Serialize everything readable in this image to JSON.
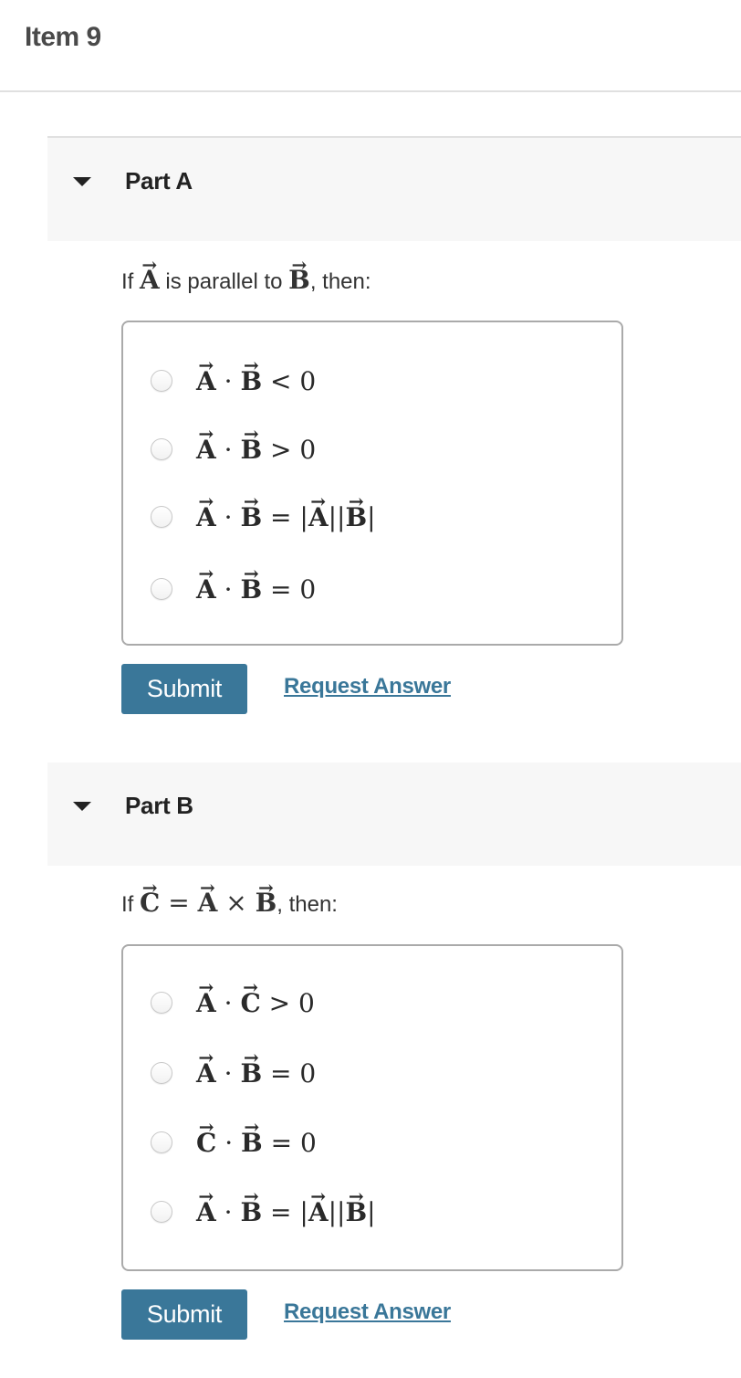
{
  "item": {
    "title": "Item 9"
  },
  "colors": {
    "accent": "#3a7799",
    "header_bg": "#f7f7f7",
    "border": "#aaaaaa"
  },
  "parts": [
    {
      "title": "Part A",
      "expanded": true,
      "prompt": {
        "prefix": "If ",
        "v1": "A",
        "middle": " is parallel to ",
        "v2": "B",
        "suffix": ", then:"
      },
      "choices": [
        {
          "text": "A · B < 0",
          "lhs1": "A",
          "dot": "·",
          "lhs2": "B",
          "rel": "< 0",
          "selected": false
        },
        {
          "text": "A · B > 0",
          "lhs1": "A",
          "dot": "·",
          "lhs2": "B",
          "rel": "> 0",
          "selected": false
        },
        {
          "text": "A · B = |A||B|",
          "lhs1": "A",
          "dot": "·",
          "lhs2": "B",
          "eq": "= |",
          "r1": "A",
          "mid": "||",
          "r2": "B",
          "end": "|",
          "selected": false
        },
        {
          "text": "A · B = 0",
          "lhs1": "A",
          "dot": "·",
          "lhs2": "B",
          "rel": "= 0",
          "selected": false
        }
      ],
      "submit_label": "Submit",
      "request_label": "Request Answer"
    },
    {
      "title": "Part B",
      "expanded": true,
      "prompt": {
        "prefix": "If ",
        "v1": "C",
        "eq": " = ",
        "v2": "A",
        "cross": " × ",
        "v3": "B",
        "suffix": ", then:"
      },
      "choices": [
        {
          "text": "A · C > 0",
          "lhs1": "A",
          "dot": "·",
          "lhs2": "C",
          "rel": "> 0",
          "selected": false
        },
        {
          "text": "A · B = 0",
          "lhs1": "A",
          "dot": "·",
          "lhs2": "B",
          "rel": "= 0",
          "selected": false
        },
        {
          "text": "C · B = 0",
          "lhs1": "C",
          "dot": "·",
          "lhs2": "B",
          "rel": "= 0",
          "selected": false
        },
        {
          "text": "A · B = |A||B|",
          "lhs1": "A",
          "dot": "·",
          "lhs2": "B",
          "eq": "= |",
          "r1": "A",
          "mid": "||",
          "r2": "B",
          "end": "|",
          "selected": false
        }
      ],
      "submit_label": "Submit",
      "request_label": "Request Answer"
    }
  ]
}
